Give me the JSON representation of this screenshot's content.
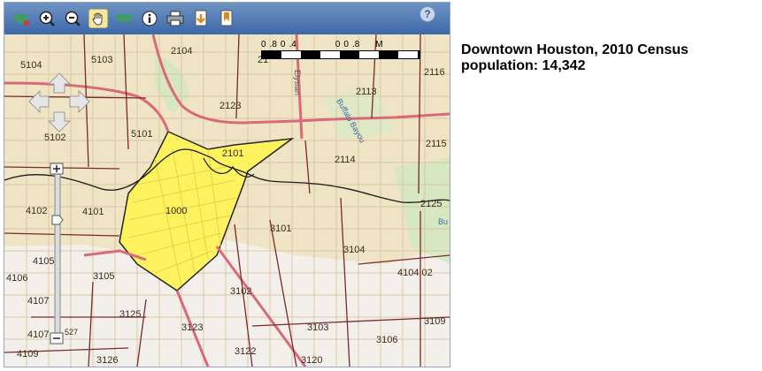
{
  "toolbar": {
    "items": [
      {
        "icon": "full-extent-icon",
        "color": "#2e8b57"
      },
      {
        "icon": "zoom-in-icon",
        "color": "#1b1b1b"
      },
      {
        "icon": "zoom-out-icon",
        "color": "#1b1b1b"
      },
      {
        "icon": "pan-hand-icon",
        "color": "#8b5a2b",
        "active": true
      },
      {
        "icon": "us-map-icon",
        "color": "#2e8b57"
      },
      {
        "icon": "info-icon",
        "color": "#1b1b1b"
      },
      {
        "icon": "print-icon",
        "color": "#1b1b1b"
      },
      {
        "icon": "export-icon",
        "color": "#e08a1e"
      },
      {
        "icon": "bookmark-icon",
        "color": "#e08a1e"
      }
    ],
    "help_label": "?"
  },
  "scalebar": {
    "labels": [
      "0",
      ".8",
      "0",
      ".4",
      "0",
      "0",
      ".8",
      "M"
    ]
  },
  "map": {
    "highlight_color": "#fff35a",
    "tracts": [
      "5104",
      "5103",
      "2104",
      "21",
      "2116",
      "2113",
      "2123",
      "5102",
      "5101",
      "2101",
      "2114",
      "2115",
      "2125",
      "4102",
      "4101",
      "1000",
      "3101",
      "3104",
      "4105",
      "4104.02",
      "4106",
      "3105",
      "4107",
      "3102",
      "3125",
      "3123",
      "3103",
      "3109",
      "4107",
      "3106",
      "4109",
      "3126",
      "3122",
      "3120",
      "527",
      "Bu"
    ],
    "street_labels": [
      "Elysian",
      "Buffalo Bayou"
    ]
  },
  "info": {
    "line1": "Downtown Houston, 2010 Census",
    "line2": "population: 14,342"
  }
}
